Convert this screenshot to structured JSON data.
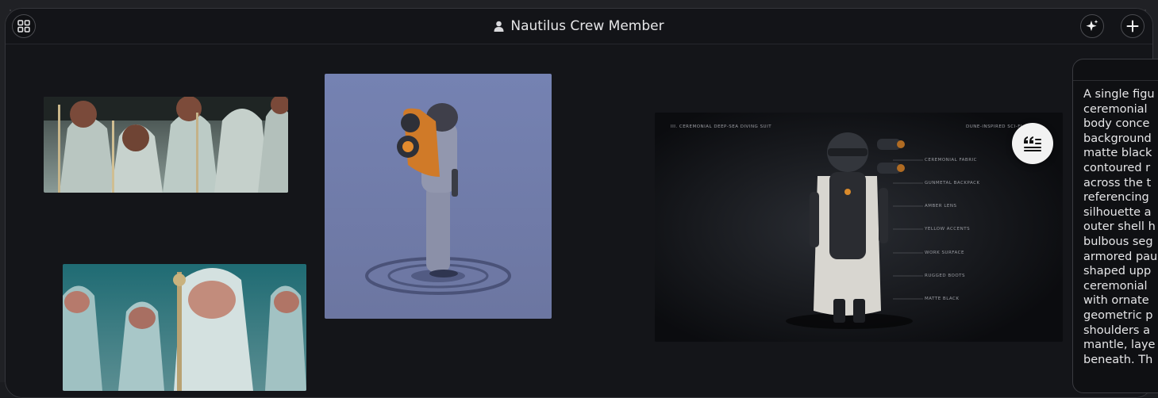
{
  "header": {
    "title": "Nautilus Crew Member",
    "grid_icon": "grid-icon",
    "user_icon": "user-icon",
    "sparkle_icon": "sparkle-icon",
    "add_icon": "plus-icon"
  },
  "concept_sheet": {
    "heading_left": "III. CEREMONIAL DEEP-SEA DIVING SUIT",
    "heading_right": "DUNE-INSPIRED SCI-FI",
    "labels": [
      "CEREMONIAL FABRIC",
      "GUNMETAL BACKPACK",
      "AMBER LENS",
      "YELLOW ACCENTS",
      "WORK SURFACE",
      "RUGGED BOOTS",
      "MATTE BLACK"
    ]
  },
  "description_panel": {
    "lines": [
      "A single figu",
      "ceremonial",
      "body conce",
      "background",
      "matte black",
      "contoured r",
      "across the t",
      "referencing",
      "silhouette a",
      "outer shell h",
      "bulbous seg",
      "armored pau",
      "shaped upp",
      "ceremonial",
      "with ornate",
      "geometric p",
      "shoulders a",
      "mantle, laye",
      "beneath. Th"
    ]
  },
  "colors": {
    "background": "#141519",
    "accent_orange": "#d9822b",
    "panel_text": "#e6e6e8"
  }
}
